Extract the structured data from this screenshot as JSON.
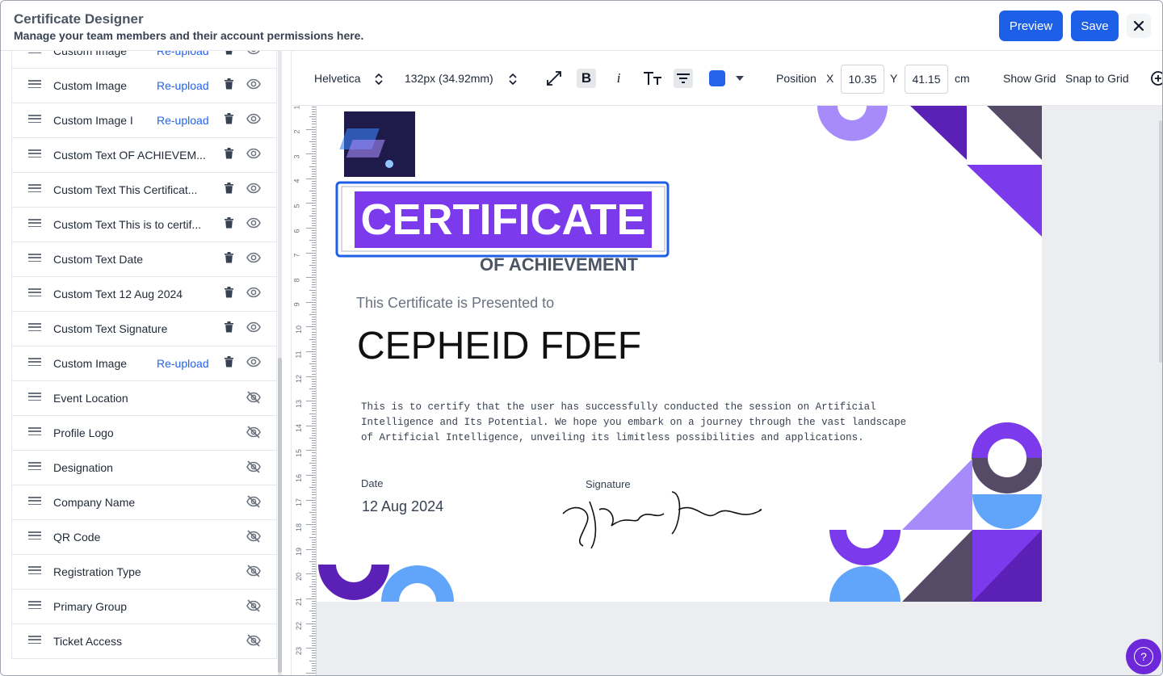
{
  "header": {
    "title": "Certificate Designer",
    "subtitle": "Manage your team members and their account permissions here.",
    "preview_label": "Preview",
    "save_label": "Save",
    "close_icon": "close-icon"
  },
  "layers": [
    {
      "label": "Custom Image",
      "reupload": "Re-upload",
      "visible": true
    },
    {
      "label": "Custom Image",
      "reupload": "Re-upload",
      "visible": true
    },
    {
      "label": "Custom Image I",
      "reupload": "Re-upload",
      "visible": true
    },
    {
      "label": "Custom Text OF ACHIEVEM...",
      "reupload": "",
      "visible": true
    },
    {
      "label": "Custom Text This Certificat...",
      "reupload": "",
      "visible": true
    },
    {
      "label": "Custom Text This is to certif...",
      "reupload": "",
      "visible": true
    },
    {
      "label": "Custom Text Date",
      "reupload": "",
      "visible": true
    },
    {
      "label": "Custom Text 12 Aug 2024",
      "reupload": "",
      "visible": true
    },
    {
      "label": "Custom Text Signature",
      "reupload": "",
      "visible": true
    },
    {
      "label": "Custom Image",
      "reupload": "Re-upload",
      "visible": true
    },
    {
      "label": "Event Location",
      "reupload": "",
      "visible": false
    },
    {
      "label": "Profile Logo",
      "reupload": "",
      "visible": false
    },
    {
      "label": "Designation",
      "reupload": "",
      "visible": false
    },
    {
      "label": "Company Name",
      "reupload": "",
      "visible": false
    },
    {
      "label": "QR Code",
      "reupload": "",
      "visible": false
    },
    {
      "label": "Registration Type",
      "reupload": "",
      "visible": false
    },
    {
      "label": "Primary Group",
      "reupload": "",
      "visible": false
    },
    {
      "label": "Ticket Access",
      "reupload": "",
      "visible": false
    }
  ],
  "toolbar": {
    "font": "Helvetica",
    "size": "132px (34.92mm)",
    "color": "#2563eb",
    "position_label": "Position",
    "x_label": "X",
    "x_value": "10.35",
    "y_label": "Y",
    "y_value": "41.15",
    "unit": "cm",
    "show_grid": "Show Grid",
    "snap_grid": "Snap to Grid"
  },
  "ruler_numbers": [
    "1",
    "2",
    "3",
    "4",
    "5",
    "6",
    "7",
    "8",
    "9",
    "10",
    "11",
    "12",
    "13",
    "14",
    "15",
    "16",
    "17",
    "18",
    "19",
    "20",
    "21",
    "22",
    "23"
  ],
  "certificate": {
    "title": "CERTIFICATE",
    "subtitle": "OF ACHIEVEMENT",
    "presented": "This Certificate is Presented to",
    "name": "CEPHEID FDEF",
    "body_1": "This is to certify that the user has successfully conducted the session on Artificial",
    "body_2": "Intelligence and Its Potential. We hope you embark on a journey through the vast landscape",
    "body_3": "of Artificial Intelligence, unveiling its limitless possibilities and applications.",
    "date_label": "Date",
    "date_value": "12 Aug 2024",
    "signature_label": "Signature",
    "accent": "#7c3aed",
    "accent_light": "#a78bfa",
    "dark_accent": "#5b21b6",
    "blue_accent": "#60a5fa",
    "slate": "#564b66"
  }
}
